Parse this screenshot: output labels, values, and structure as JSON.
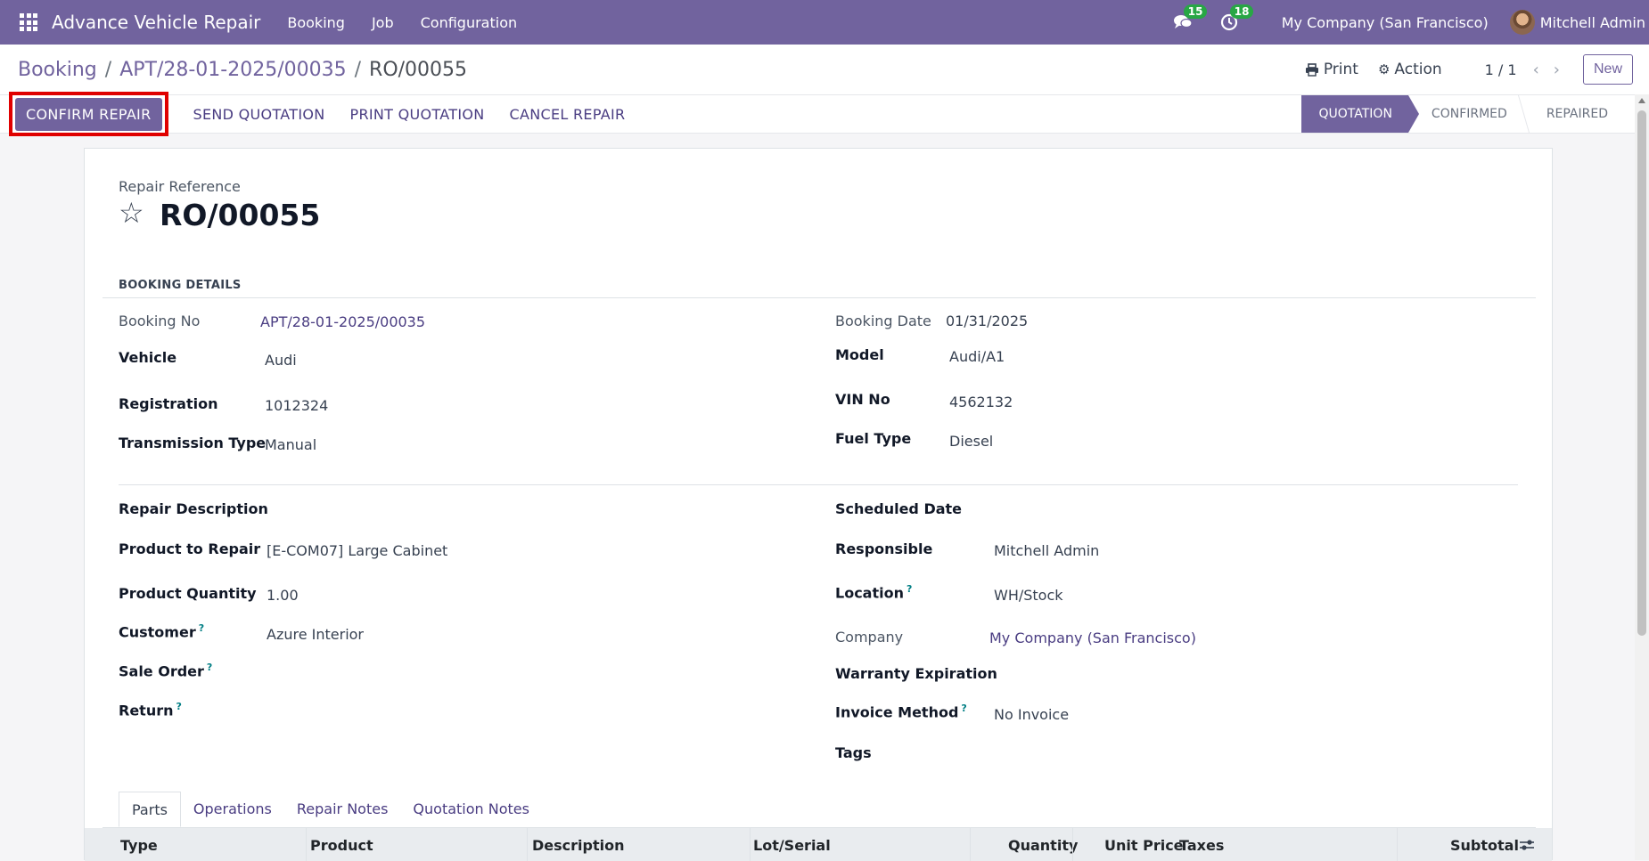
{
  "navbar": {
    "app_name": "Advance Vehicle Repair",
    "menus": [
      "Booking",
      "Job",
      "Configuration"
    ],
    "messages_count": "15",
    "activities_count": "18",
    "company": "My Company (San Francisco)",
    "user": "Mitchell Admin"
  },
  "breadcrumb": {
    "root": "Booking",
    "parent": "APT/28-01-2025/00035",
    "current": "RO/00055",
    "sep": "/"
  },
  "control": {
    "print_label": "Print",
    "action_label": "Action",
    "pager": "1 / 1",
    "new_label": "New"
  },
  "statusbar": {
    "confirm_label": "CONFIRM REPAIR",
    "send_label": "SEND QUOTATION",
    "print_label": "PRINT QUOTATION",
    "cancel_label": "CANCEL REPAIR",
    "stages": [
      "QUOTATION",
      "CONFIRMED",
      "REPAIRED"
    ]
  },
  "form": {
    "ref_label": "Repair Reference",
    "ref_value": "RO/00055",
    "section_title": "BOOKING DETAILS",
    "booking_no_label": "Booking No",
    "booking_no": "APT/28-01-2025/00035",
    "booking_date_label": "Booking Date",
    "booking_date": "01/31/2025",
    "vehicle_label": "Vehicle",
    "vehicle": "Audi",
    "model_label": "Model",
    "model": "Audi/A1",
    "registration_label": "Registration",
    "registration": "1012324",
    "vin_label": "VIN No",
    "vin": "4562132",
    "transmission_label": "Transmission Type",
    "transmission": "Manual",
    "fuel_label": "Fuel Type",
    "fuel": "Diesel",
    "repair_desc_label": "Repair Description",
    "scheduled_label": "Scheduled Date",
    "product_label": "Product to Repair",
    "product": "[E-COM07] Large Cabinet",
    "responsible_label": "Responsible",
    "responsible": "Mitchell Admin",
    "qty_label": "Product Quantity",
    "qty": "1.00",
    "location_label": "Location",
    "location": "WH/Stock",
    "customer_label": "Customer",
    "customer": "Azure Interior",
    "company_label": "Company",
    "company": "My Company (San Francisco)",
    "sale_order_label": "Sale Order",
    "warranty_label": "Warranty Expiration",
    "return_label": "Return",
    "invoice_label": "Invoice Method",
    "invoice": "No Invoice",
    "tags_label": "Tags",
    "tooltip_mark": "?"
  },
  "tabs": [
    "Parts",
    "Operations",
    "Repair Notes",
    "Quotation Notes"
  ],
  "table": {
    "columns": [
      "Type",
      "Product",
      "Description",
      "Lot/Serial",
      "Quantity",
      "Unit Price",
      "Taxes",
      "Subtotal"
    ]
  }
}
